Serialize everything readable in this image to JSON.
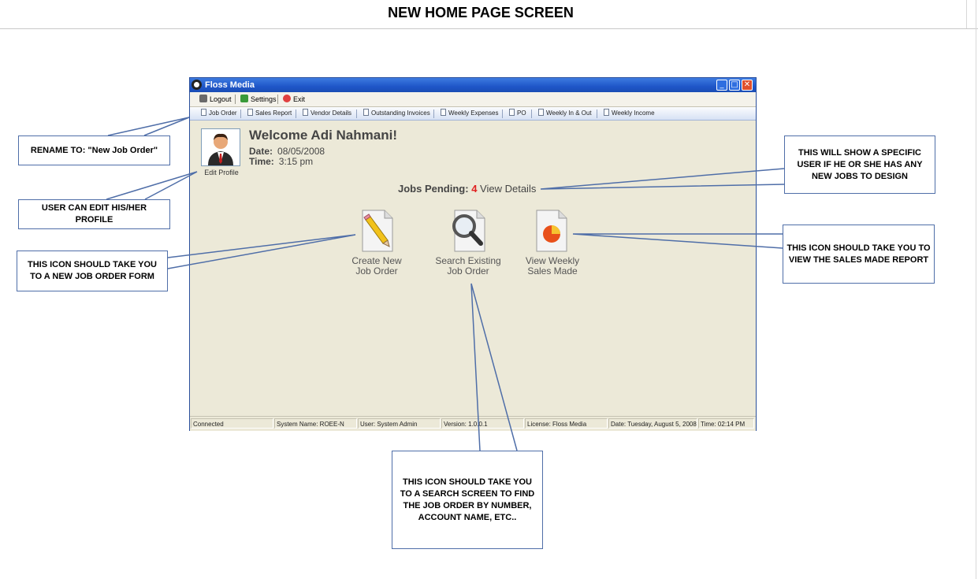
{
  "page": {
    "title": "NEW HOME PAGE SCREEN"
  },
  "window": {
    "title": "Floss Media",
    "controls": {
      "minimize": "_",
      "maximize": "□",
      "close": "✕"
    }
  },
  "menu": {
    "logout": "Logout",
    "settings": "Settings",
    "exit": "Exit"
  },
  "toolbar": {
    "tabs": [
      "Job Order",
      "Sales Report",
      "Vendor Details",
      "Outstanding Invoices",
      "Weekly Expenses",
      "PO",
      "Weekly In & Out",
      "Weekly Income"
    ]
  },
  "profile": {
    "edit_label": "Edit Profile",
    "welcome": "Welcome Adi Nahmani!",
    "date_label": "Date:",
    "date_value": "08/05/2008",
    "time_label": "Time:",
    "time_value": "3:15 pm"
  },
  "jobs": {
    "pending_label": "Jobs Pending:",
    "pending_count": "4",
    "details_link": "View Details"
  },
  "actions": {
    "create": {
      "line1": "Create New",
      "line2": "Job Order",
      "icon": "pencil-document-icon"
    },
    "search": {
      "line1": "Search Existing",
      "line2": "Job Order",
      "icon": "magnifier-document-icon"
    },
    "sales": {
      "line1": "View Weekly",
      "line2": "Sales Made",
      "icon": "pie-chart-document-icon"
    }
  },
  "status_bar": {
    "connected": "Connected",
    "system_name": "System Name:  ROEE-N",
    "user": "User:  System Admin",
    "version": "Version: 1.0.0.1",
    "license": "License: Floss Media",
    "date": "Date: Tuesday, August 5, 2008",
    "time": "Time: 02:14 PM"
  },
  "callouts": {
    "rename": "RENAME TO: \"New Job Order\"",
    "edit_profile": "USER CAN EDIT HIS/HER PROFILE",
    "new_job": "THIS ICON SHOULD TAKE YOU TO A NEW JOB ORDER FORM",
    "pending": "THIS WILL SHOW A SPECIFIC USER IF HE OR SHE HAS ANY NEW JOBS TO DESIGN",
    "sales": "THIS ICON SHOULD TAKE YOU TO VIEW THE SALES MADE REPORT",
    "search": "THIS ICON SHOULD TAKE YOU TO A SEARCH SCREEN TO FIND THE JOB ORDER BY NUMBER, ACCOUNT NAME, ETC.."
  },
  "colors": {
    "title_bar": "#1f56c8",
    "callout_border": "#4f6ea8",
    "pending_count": "#e02020",
    "window_bg": "#ece9d8"
  }
}
